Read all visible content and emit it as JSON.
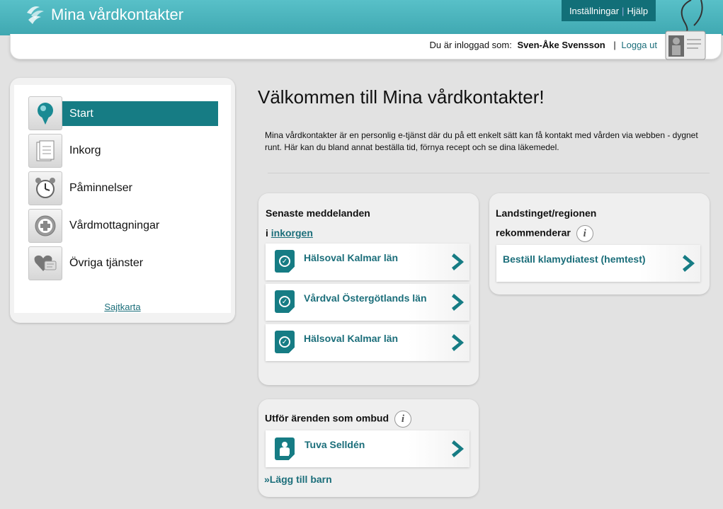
{
  "header": {
    "app_title": "Mina vårdkontakter",
    "settings_label": "Inställningar",
    "help_label": "Hjälp",
    "logged_in_prefix": "Du är inloggad som:",
    "user_name": "Sven-Åke Svensson",
    "logout_label": "Logga ut"
  },
  "sidebar": {
    "items": [
      {
        "label": "Start",
        "icon": "map-pin-icon",
        "active": true
      },
      {
        "label": "Inkorg",
        "icon": "inbox-icon",
        "active": false
      },
      {
        "label": "Påminnelser",
        "icon": "alarm-clock-icon",
        "active": false
      },
      {
        "label": "Vårdmottagningar",
        "icon": "medical-cross-icon",
        "active": false
      },
      {
        "label": "Övriga tjänster",
        "icon": "heart-chat-icon",
        "active": false
      }
    ],
    "sitemap_label": "Sajtkarta"
  },
  "main": {
    "welcome_title": "Välkommen till Mina vårdkontakter!",
    "intro_text": "Mina vårdkontakter är en personlig e-tjänst där du på ett enkelt sätt kan få kontakt med vården via webben - dygnet runt. Här kan du bland annat beställa tid, förnya recept och se dina läkemedel."
  },
  "messages_panel": {
    "title": "Senaste meddelanden",
    "sub_prefix": "i",
    "sub_link": "inkorgen",
    "items": [
      {
        "label": "Hälsoval Kalmar län"
      },
      {
        "label": "Vårdval Östergötlands län"
      },
      {
        "label": "Hälsoval Kalmar län"
      }
    ]
  },
  "region_panel": {
    "title_line1": "Landstinget/regionen",
    "title_line2": "rekommenderar",
    "items": [
      {
        "label": "Beställ klamydiatest (hemtest)"
      }
    ]
  },
  "agent_panel": {
    "title": "Utför ärenden som ombud",
    "items": [
      {
        "label": "Tuva Selldén"
      }
    ],
    "add_child_label": "»Lägg till barn"
  },
  "colors": {
    "header": "#4fb9c1",
    "accent": "#167c84",
    "link": "#1b6e7a",
    "background": "#e2e2e2"
  }
}
